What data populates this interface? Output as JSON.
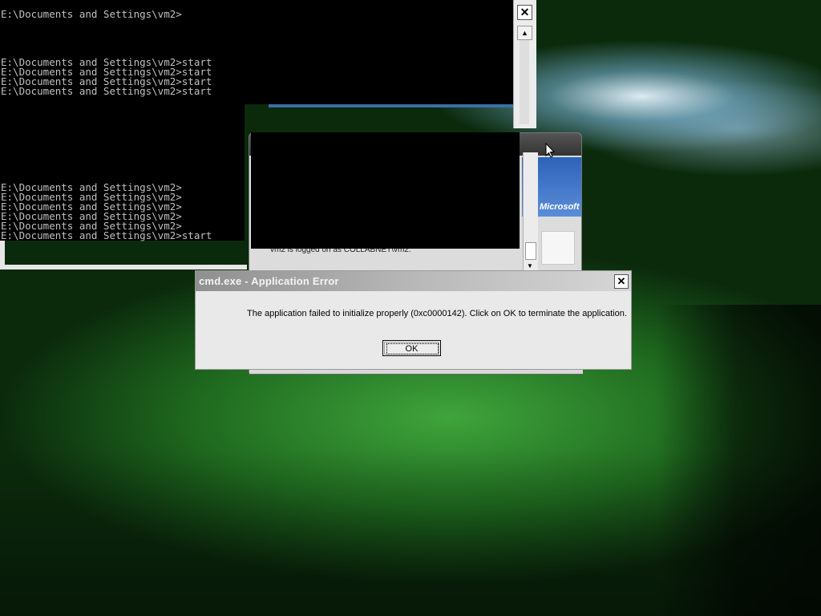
{
  "console": {
    "lines_top": [
      "E:\\Documents and Settings\\vm2>",
      "",
      "",
      "",
      "",
      "E:\\Documents and Settings\\vm2>start",
      "E:\\Documents and Settings\\vm2>start",
      "E:\\Documents and Settings\\vm2>start",
      "E:\\Documents and Settings\\vm2>start"
    ],
    "lines_bottom": [
      "E:\\Documents and Settings\\vm2>",
      "E:\\Documents and Settings\\vm2>",
      "E:\\Documents and Settings\\vm2>",
      "E:\\Documents and Settings\\vm2>",
      "E:\\Documents and Settings\\vm2>",
      "E:\\Documents and Settings\\vm2>start"
    ],
    "close_glyph": "✕",
    "scroll_up_glyph": "▲"
  },
  "login_window": {
    "brand": "Microsoft",
    "partial_text": "vm2 is logged on as COLLABNET\\vm2.",
    "scroll_down_glyph": "▼"
  },
  "error_dialog": {
    "title": "cmd.exe - Application Error",
    "message": "The application failed to initialize properly (0xc0000142). Click on OK to terminate the application.",
    "ok_label": "OK",
    "close_glyph": "✕"
  },
  "icons": {
    "cursor": "arrow-cursor-icon"
  }
}
